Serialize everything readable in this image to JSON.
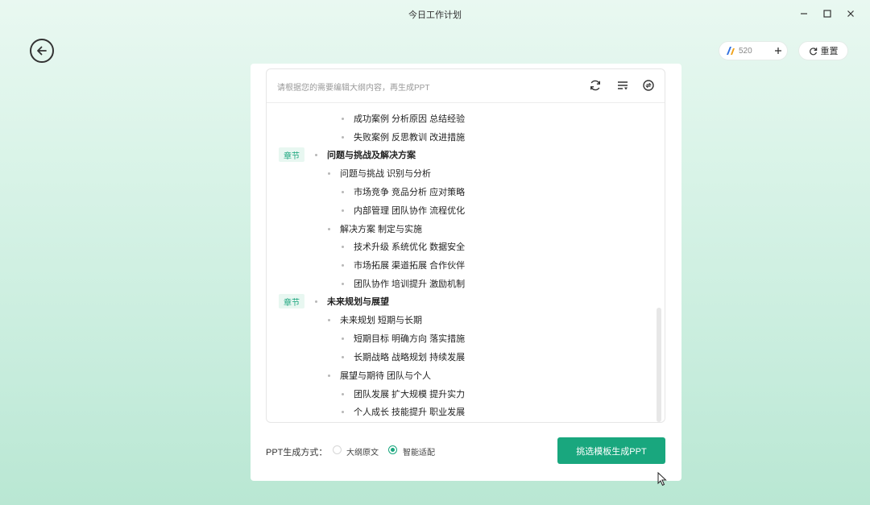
{
  "window": {
    "title": "今日工作计划"
  },
  "toolbar": {
    "credits_value": "520",
    "reset_label": "重置"
  },
  "editor": {
    "hint": "请根据您的需要编辑大纲内容，再生成PPT",
    "chapter_tag": "章节",
    "rows": [
      {
        "level": 3,
        "text": "成功案例 分析原因 总结经验"
      },
      {
        "level": 3,
        "text": "失败案例 反思教训 改进措施"
      },
      {
        "level": 1,
        "text": "问题与挑战及解决方案"
      },
      {
        "level": 2,
        "text": "问题与挑战 识别与分析"
      },
      {
        "level": 3,
        "text": "市场竞争 竞品分析 应对策略"
      },
      {
        "level": 3,
        "text": "内部管理 团队协作 流程优化"
      },
      {
        "level": 2,
        "text": "解决方案 制定与实施"
      },
      {
        "level": 3,
        "text": "技术升级 系统优化 数据安全"
      },
      {
        "level": 3,
        "text": "市场拓展 渠道拓展 合作伙伴"
      },
      {
        "level": 3,
        "text": "团队协作 培训提升 激励机制"
      },
      {
        "level": 1,
        "text": "未来规划与展望"
      },
      {
        "level": 2,
        "text": "未来规划 短期与长期"
      },
      {
        "level": 3,
        "text": "短期目标 明确方向 落实措施"
      },
      {
        "level": 3,
        "text": "长期战略 战略规划 持续发展"
      },
      {
        "level": 2,
        "text": "展望与期待 团队与个人"
      },
      {
        "level": 3,
        "text": "团队发展 扩大规模 提升实力"
      },
      {
        "level": 3,
        "text": "个人成长 技能提升 职业发展"
      }
    ]
  },
  "footer": {
    "mode_label": "PPT生成方式：",
    "options": [
      {
        "label": "大纲原文",
        "selected": false
      },
      {
        "label": "智能适配",
        "selected": true
      }
    ],
    "generate_button": "挑选模板生成PPT"
  },
  "colors": {
    "accent": "#19a77e"
  }
}
